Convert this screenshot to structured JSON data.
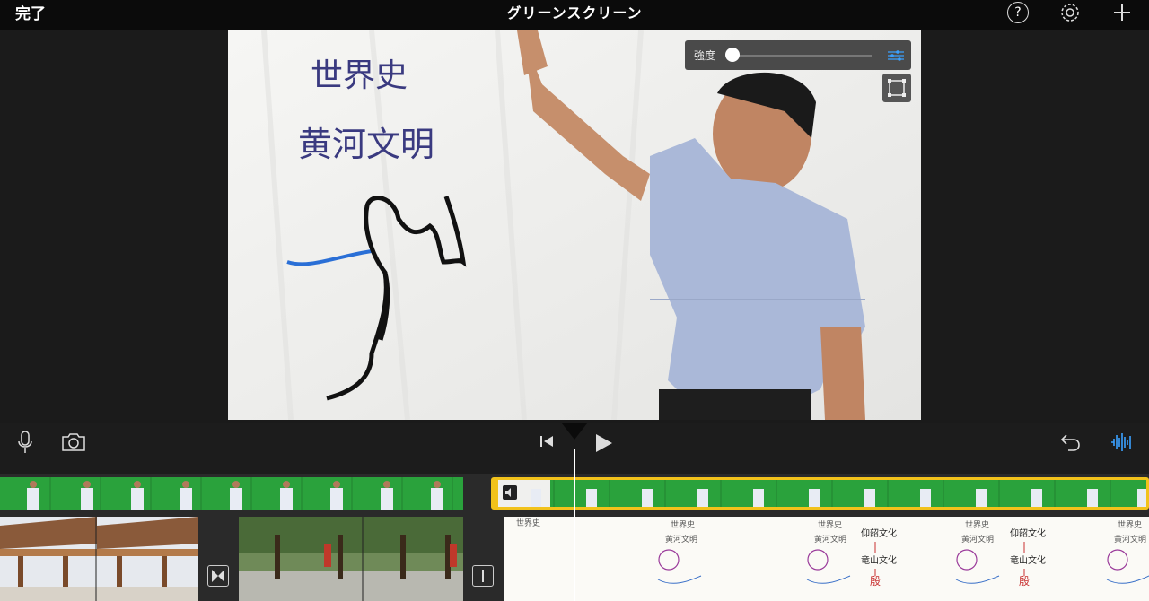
{
  "header": {
    "done_label": "完了",
    "title": "グリーンスクリーン",
    "icons": [
      "help-icon",
      "settings-gear-icon",
      "add-plus-icon"
    ]
  },
  "preview": {
    "strength_label": "強度",
    "strength_value": 0.0,
    "board_text_line1": "世界史",
    "board_text_line2": "黄河文明"
  },
  "toolbar": {
    "icons": [
      "microphone-icon",
      "camera-icon",
      "skip-to-start-icon",
      "play-icon",
      "undo-icon",
      "audio-waveform-icon"
    ]
  },
  "timeline": {
    "notes_text": [
      "世界史",
      "黄河文明",
      "仰韶文化",
      "竜山文化",
      "殷"
    ]
  },
  "colors": {
    "accent_yellow": "#f2c21b",
    "green_screen": "#26a03a",
    "waveform_blue": "#3aa0ff"
  }
}
